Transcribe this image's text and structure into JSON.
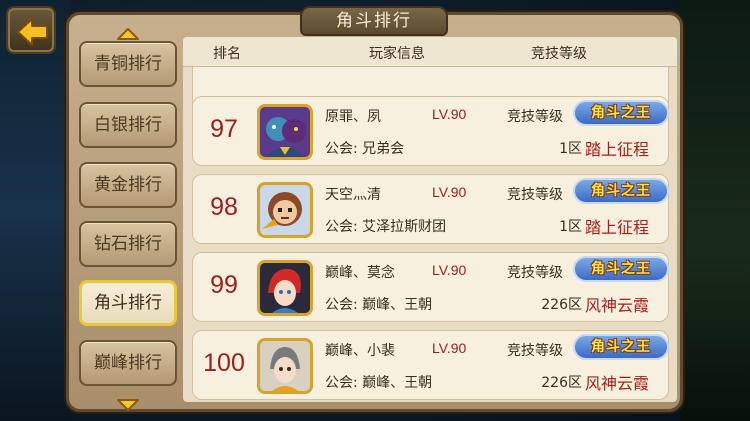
{
  "title": "角斗排行",
  "back_icon": "arrow-left-icon",
  "side_menu": {
    "items": [
      {
        "label": "青铜排行",
        "active": false
      },
      {
        "label": "白银排行",
        "active": false
      },
      {
        "label": "黄金排行",
        "active": false
      },
      {
        "label": "钻石排行",
        "active": false
      },
      {
        "label": "角斗排行",
        "active": true
      },
      {
        "label": "巅峰排行",
        "active": false
      }
    ]
  },
  "header": {
    "rank": "排名",
    "player_info": "玩家信息",
    "arena_level": "竞技等级"
  },
  "players": [
    {
      "rank": "97",
      "name": "原罪、夙",
      "level": "LV.90",
      "level_label": "竞技等级",
      "badge": "角斗之王",
      "guild": "公会: 兄弟会",
      "server": "1区",
      "region": "踏上征程"
    },
    {
      "rank": "98",
      "name": "天空灬清",
      "level": "LV.90",
      "level_label": "竞技等级",
      "badge": "角斗之王",
      "guild": "公会: 艾泽拉斯财团",
      "server": "1区",
      "region": "踏上征程"
    },
    {
      "rank": "99",
      "name": "巅峰、莫念",
      "level": "LV.90",
      "level_label": "竞技等级",
      "badge": "角斗之王",
      "guild": "公会: 巅峰、王朝",
      "server": "226区",
      "region": "风神云霞"
    },
    {
      "rank": "100",
      "name": "巅峰、小裴",
      "level": "LV.90",
      "level_label": "竞技等级",
      "badge": "角斗之王",
      "guild": "公会: 巅峰、王朝",
      "server": "226区",
      "region": "风神云霞"
    }
  ],
  "colors": {
    "rank_red": "#9a1e1e",
    "region_red": "#a8201e",
    "active_border": "#e8c838",
    "badge_blue": "#3c6ac4",
    "badge_text": "#ffe24a"
  }
}
